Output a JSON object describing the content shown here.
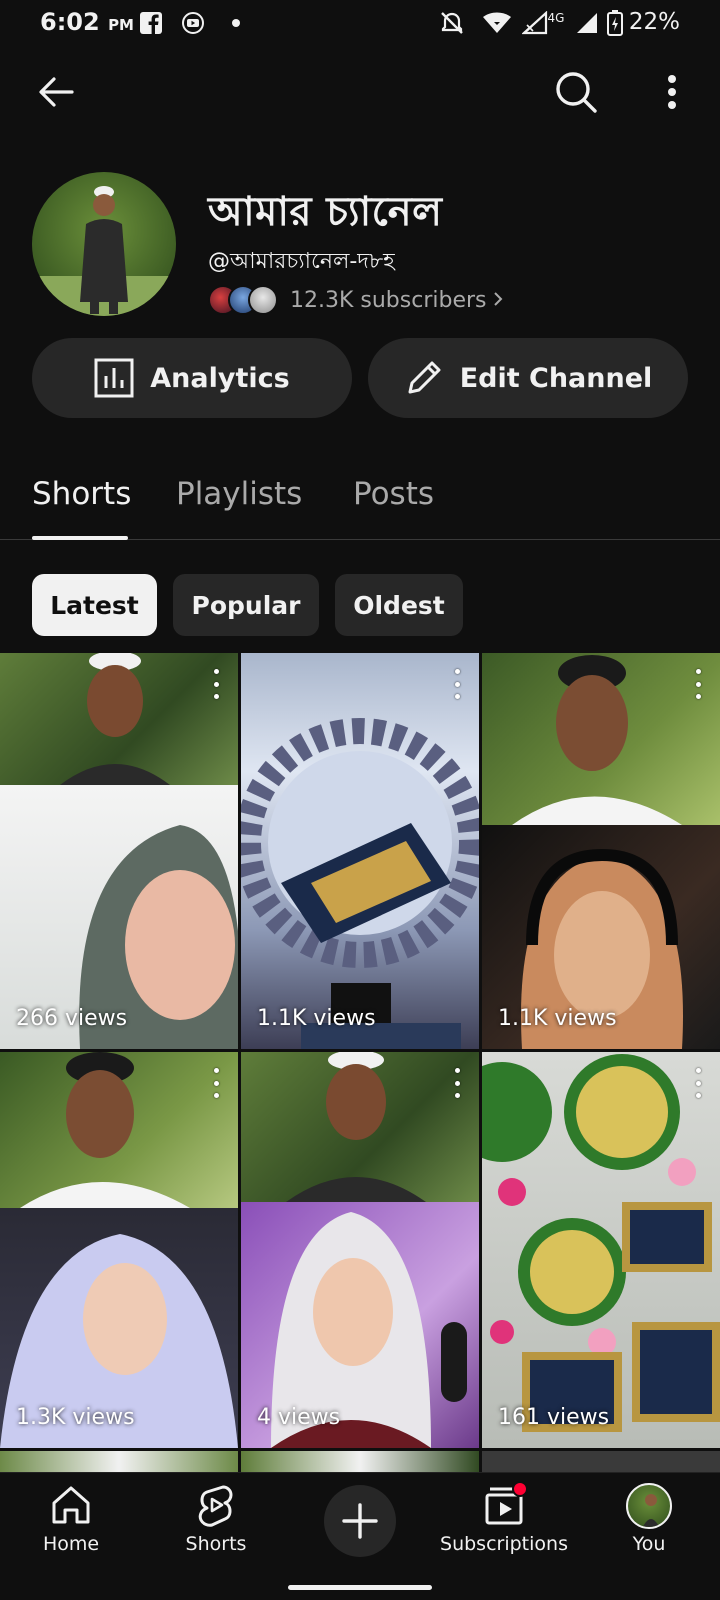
{
  "status_bar": {
    "time": "6:02",
    "ampm": "PM",
    "network": "4G",
    "battery": "22%"
  },
  "top_bar": {
    "back_icon": "arrow-left-icon",
    "search_icon": "search-icon",
    "more_icon": "more-vertical-icon"
  },
  "channel": {
    "name": "আমার চ্যানেল",
    "handle": "@আমারচ্যানেল-দ৮হ",
    "subscribers": "12.3K subscribers"
  },
  "actions": {
    "analytics_label": "Analytics",
    "edit_label": "Edit Channel"
  },
  "tabs": [
    {
      "label": "Shorts",
      "active": true
    },
    {
      "label": "Playlists",
      "active": false
    },
    {
      "label": "Posts",
      "active": false
    }
  ],
  "chips": [
    {
      "label": "Latest",
      "selected": true
    },
    {
      "label": "Popular",
      "selected": false
    },
    {
      "label": "Oldest",
      "selected": false
    }
  ],
  "shorts": [
    {
      "views": "266 views"
    },
    {
      "views": "1.1K views"
    },
    {
      "views": "1.1K views"
    },
    {
      "views": "1.3K views"
    },
    {
      "views": "4 views"
    },
    {
      "views": "161 views"
    }
  ],
  "bottom_nav": [
    {
      "label": "Home",
      "icon": "home-icon"
    },
    {
      "label": "Shorts",
      "icon": "shorts-icon"
    },
    {
      "label": "",
      "icon": "plus-icon"
    },
    {
      "label": "Subscriptions",
      "icon": "subscriptions-icon"
    },
    {
      "label": "You",
      "icon": "avatar"
    }
  ],
  "colors": {
    "background": "#0f0f0f",
    "surface": "#272727",
    "text": "#f1f1f1",
    "secondary_text": "#aaaaaa",
    "notification_dot": "#ff0033"
  }
}
